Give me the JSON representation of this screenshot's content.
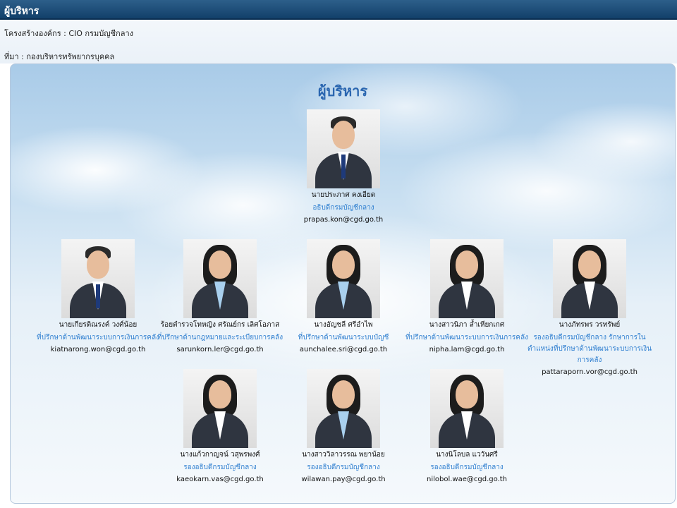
{
  "window": {
    "title": "ผู้บริหาร"
  },
  "meta": {
    "structure": "โครงสร้างองค์กร : CIO กรมบัญชีกลาง",
    "source": "ที่มา : กองบริหารทรัพยากรบุคคล"
  },
  "panel": {
    "heading": "ผู้บริหาร"
  },
  "people": [
    {
      "name": "นายประภาศ คงเอียด",
      "role": "อธิบดีกรมบัญชีกลาง",
      "email": "prapas.kon@cgd.go.th"
    },
    {
      "name": "นายเกียรติณรงค์ วงศ์น้อย",
      "role": "ที่ปรึกษาด้านพัฒนาระบบการเงินการคลัง",
      "email": "kiatnarong.won@cgd.go.th"
    },
    {
      "name": "ร้อยตำรวจโทหญิง ศรัณย์กร เลิศโอภาส",
      "role": "ที่ปรึกษาด้านกฎหมายและระเบียบการคลัง",
      "email": "sarunkorn.ler@cgd.go.th"
    },
    {
      "name": "นางอัญชลี ศรีอำไพ",
      "role": "ที่ปรึกษาด้านพัฒนาระบบบัญชี",
      "email": "aunchalee.sri@cgd.go.th"
    },
    {
      "name": "นางสาวนิภา ล้ำเหียกเกศ",
      "role": "ที่ปรึกษาด้านพัฒนาระบบการเงินการคลัง",
      "email": "nipha.lam@cgd.go.th"
    },
    {
      "name": "นางภัทรพร วรทรัพย์",
      "role": "รองอธิบดีกรมบัญชีกลาง รักษาการใน ตำแหน่งที่ปรึกษาด้านพัฒนาระบบการเงิน การคลัง",
      "email": "pattaraporn.vor@cgd.go.th"
    },
    {
      "name": "นางแก้วกาญจน์ วสุพรพงศ์",
      "role": "รองอธิบดีกรมบัญชีกลาง",
      "email": "kaeokarn.vas@cgd.go.th"
    },
    {
      "name": "นางสาววิลาวรรณ พยาน้อย",
      "role": "รองอธิบดีกรมบัญชีกลาง",
      "email": "wilawan.pay@cgd.go.th"
    },
    {
      "name": "นางนิโลบล แววันศรี",
      "role": "รองอธิบดีกรมบัญชีกลาง",
      "email": "nilobol.wae@cgd.go.th"
    }
  ]
}
